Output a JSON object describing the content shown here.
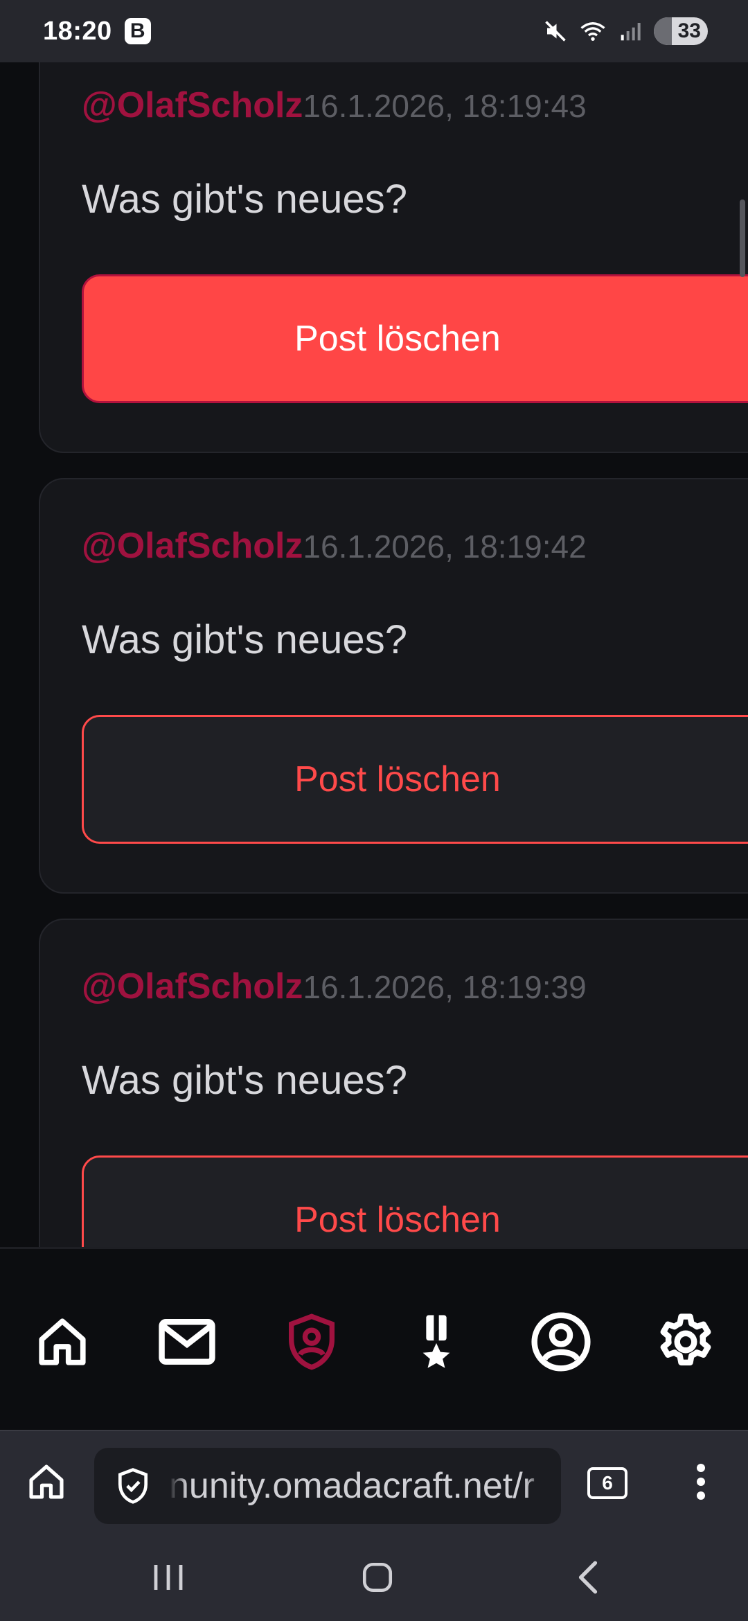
{
  "status_bar": {
    "time": "18:20",
    "app_badge": "B",
    "battery_level": "33",
    "icons": [
      "mute-icon",
      "wifi-icon",
      "signal-icon",
      "battery-icon"
    ]
  },
  "posts": [
    {
      "author": "@OlafScholz",
      "timestamp": "16.1.2026, 18:19:43",
      "text": "Was gibt's neues?",
      "delete_label": "Post löschen"
    },
    {
      "author": "@OlafScholz",
      "timestamp": "16.1.2026, 18:19:42",
      "text": "Was gibt's neues?",
      "delete_label": "Post löschen"
    },
    {
      "author": "@OlafScholz",
      "timestamp": "16.1.2026, 18:19:39",
      "text": "Was gibt's neues?",
      "delete_label": "Post löschen"
    }
  ],
  "bottom_nav": {
    "items": [
      "home-icon",
      "mail-icon",
      "moderation-shield-icon",
      "award-medal-icon",
      "profile-icon",
      "settings-gear-icon"
    ],
    "active": "moderation-shield-icon",
    "active_color": "#a0123f"
  },
  "browser": {
    "url_display": "nunity.omadacraft.net/r",
    "tab_count": "6"
  },
  "colors": {
    "accent": "#a0123f",
    "danger": "#ff4646",
    "background": "#0c0d10",
    "card": "#16171b"
  }
}
